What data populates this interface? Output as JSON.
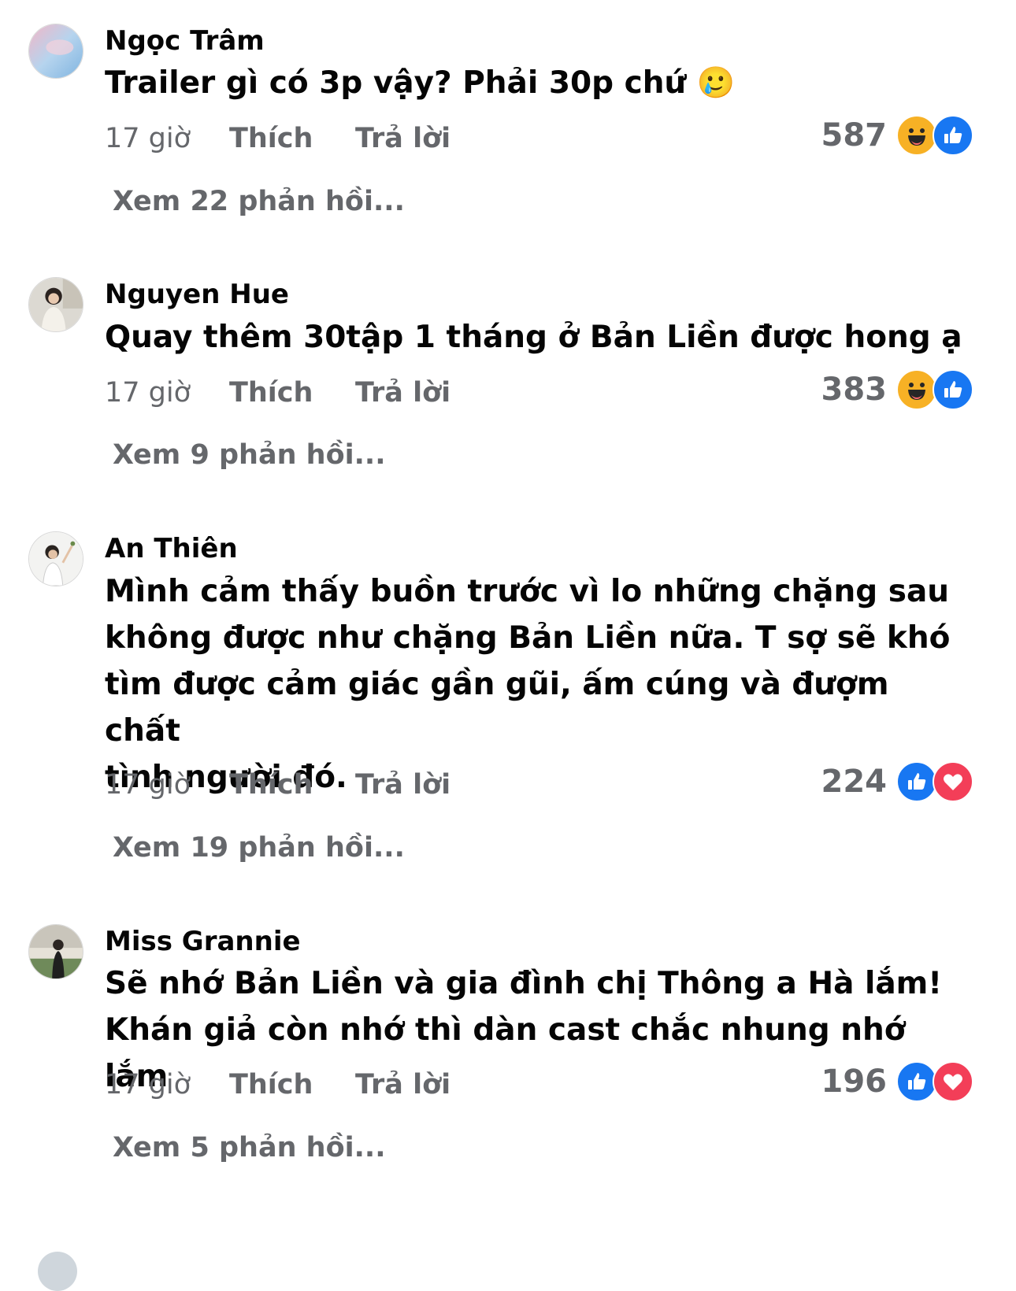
{
  "comments": [
    {
      "author": "Ngọc Trâm",
      "text": "Trailer gì có 3p vậy? Phải 30p chứ 🥲",
      "time": "17 giờ",
      "like_label": "Thích",
      "reply_label": "Trả lời",
      "reaction_count": "587",
      "reactions": [
        "haha-icon",
        "like-icon"
      ],
      "view_replies": "Xem 22 phản hồi..."
    },
    {
      "author": "Nguyen Hue",
      "text": "Quay thêm 30tập 1 tháng ở Bản Liền được hong ạ",
      "time": "17 giờ",
      "like_label": "Thích",
      "reply_label": "Trả lời",
      "reaction_count": "383",
      "reactions": [
        "haha-icon",
        "like-icon"
      ],
      "view_replies": "Xem 9 phản hồi..."
    },
    {
      "author": "An Thiên",
      "text_lines": [
        "Mình cảm thấy buồn trước vì lo những chặng sau",
        "không được như chặng Bản Liền nữa.  T sợ sẽ khó",
        "tìm được cảm giác gần gũi, ấm cúng và đượm chất",
        "tình người đó."
      ],
      "time": "17 giờ",
      "like_label": "Thích",
      "reply_label": "Trả lời",
      "reaction_count": "224",
      "reactions": [
        "like-icon",
        "love-icon"
      ],
      "view_replies": "Xem 19 phản hồi..."
    },
    {
      "author": "Miss Grannie",
      "text_lines": [
        "Sẽ nhớ Bản Liền và gia đình chị Thông a Hà lắm!",
        "Khán giả còn nhớ thì dàn cast chắc nhung nhớ lắm"
      ],
      "time": "17 giờ",
      "like_label": "Thích",
      "reply_label": "Trả lời",
      "reaction_count": "196",
      "reactions": [
        "like-icon",
        "love-icon"
      ],
      "view_replies": "Xem 5 phản hồi..."
    }
  ],
  "colors": {
    "text": "#050505",
    "secondary": "#65676b",
    "like_blue": "#1877f2",
    "love_red": "#f33e58",
    "haha_yellow": "#f7b125"
  }
}
